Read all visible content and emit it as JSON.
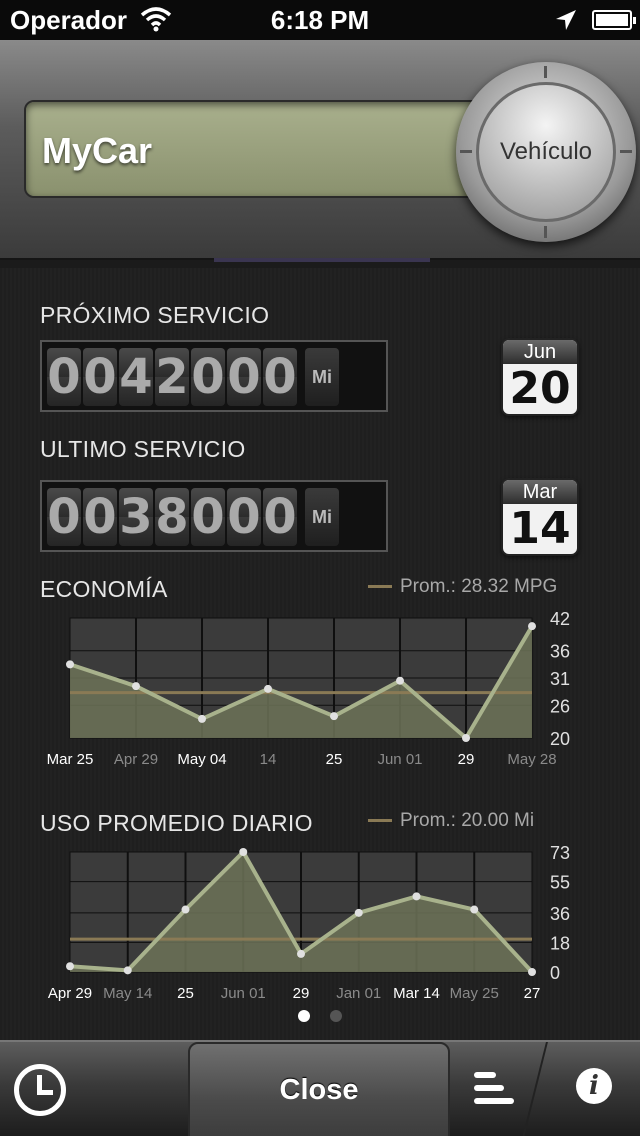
{
  "status_bar": {
    "carrier": "Operador",
    "time": "6:18 PM"
  },
  "header": {
    "vehicle_name": "MyCar",
    "vehicle_button": "Vehículo"
  },
  "next_service": {
    "label": "PRÓXIMO SERVICIO",
    "digits": [
      "0",
      "0",
      "4",
      "2",
      "0",
      "0",
      "0"
    ],
    "unit": "Mi",
    "month": "Jun",
    "day": "20"
  },
  "last_service": {
    "label": "ULTIMO SERVICIO",
    "digits": [
      "0",
      "0",
      "3",
      "8",
      "0",
      "0",
      "0"
    ],
    "unit": "Mi",
    "month": "Mar",
    "day": "14"
  },
  "economy": {
    "title": "ECONOMÍA",
    "legend": "Prom.: 28.32 MPG"
  },
  "daily_use": {
    "title": "USO PROMEDIO DIARIO",
    "legend": "Prom.: 20.00 Mi"
  },
  "tabbar": {
    "close_label": "Close"
  },
  "colors": {
    "line": "#a8b28c",
    "fill": "#6d7358",
    "avg": "#8a7a55",
    "grid": "#0f0f0f"
  },
  "chart_data": [
    {
      "type": "area",
      "title": "ECONOMÍA",
      "x": [
        "Mar 25",
        "Apr 29",
        "May 04",
        "14",
        "25",
        "Jun 01",
        "29",
        "May 28"
      ],
      "highlight_x": [
        "Mar 25",
        "May 04",
        "25",
        "29"
      ],
      "series": [
        {
          "values": [
            33.5,
            29.5,
            23.5,
            29,
            24,
            30.5,
            20,
            40.5
          ]
        }
      ],
      "average": 28.32,
      "yticks": [
        42,
        36,
        31,
        26,
        20
      ],
      "ylim": [
        20,
        42
      ],
      "grid": true
    },
    {
      "type": "area",
      "title": "USO PROMEDIO DIARIO",
      "x": [
        "Apr 29",
        "May 14",
        "25",
        "Jun 01",
        "29",
        "Jan 01",
        "Mar 14",
        "May 25",
        "27"
      ],
      "highlight_x": [
        "Apr 29",
        "25",
        "29",
        "Mar 14",
        "27"
      ],
      "series": [
        {
          "values": [
            3.5,
            1,
            38,
            73,
            11,
            36,
            46,
            38,
            0
          ]
        }
      ],
      "average": 20.0,
      "yticks": [
        73,
        55,
        36,
        18,
        0
      ],
      "ylim": [
        0,
        73
      ],
      "grid": true
    }
  ]
}
